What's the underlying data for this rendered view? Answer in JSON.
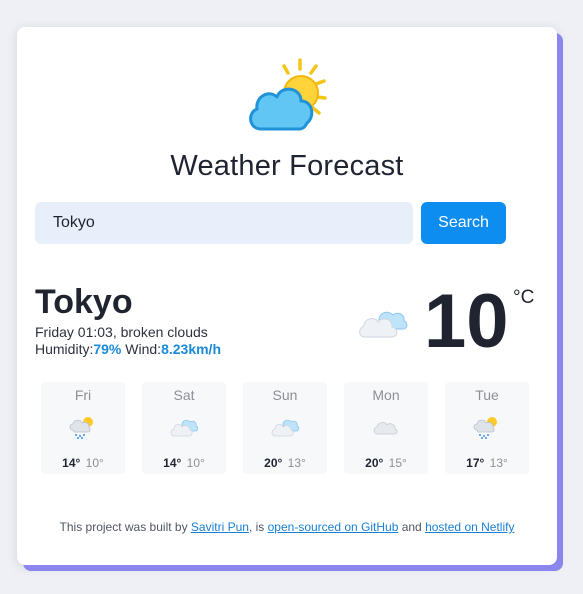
{
  "app": {
    "title": "Weather Forecast",
    "logo_icon": "sun-behind-cloud-icon"
  },
  "search": {
    "value": "Tokyo",
    "placeholder": "",
    "button_label": "Search"
  },
  "current": {
    "city": "Tokyo",
    "datetime": "Friday 01:03",
    "description": "broken clouds",
    "humidity_label": "Humidity:",
    "humidity_value": "79%",
    "wind_label": "Wind:",
    "wind_value": "8.23km/h",
    "temperature": "10",
    "unit": "°C",
    "icon": "broken-clouds-icon"
  },
  "forecast": [
    {
      "day": "Fri",
      "max": "14°",
      "min": "10°",
      "icon": "rain-cloud-sun-icon"
    },
    {
      "day": "Sat",
      "max": "14°",
      "min": "10°",
      "icon": "broken-clouds-icon"
    },
    {
      "day": "Sun",
      "max": "20°",
      "min": "13°",
      "icon": "broken-clouds-icon"
    },
    {
      "day": "Mon",
      "max": "20°",
      "min": "15°",
      "icon": "overcast-cloud-icon"
    },
    {
      "day": "Tue",
      "max": "17°",
      "min": "13°",
      "icon": "rain-cloud-sun-icon"
    }
  ],
  "footer": {
    "text1": "This project was built by ",
    "author_link": "Savitri Pun",
    "text2": ", is ",
    "github_link": "open-sourced on GitHub",
    "text3": " and ",
    "netlify_link": "hosted on Netlify"
  },
  "colors": {
    "accent": "#0d8df0",
    "input_background": "#e8effb",
    "card_shadow": "#8b86ee",
    "link": "#1a7fd0"
  }
}
